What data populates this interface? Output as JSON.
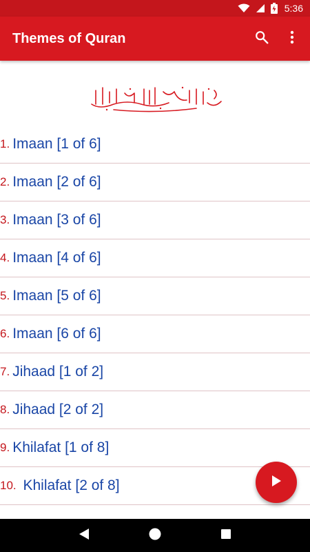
{
  "status_bar": {
    "time": "5:36",
    "icons": [
      "wifi-icon",
      "signal-icon",
      "battery-charging-icon"
    ]
  },
  "app_bar": {
    "title": "Themes of Quran",
    "actions": [
      "search-icon",
      "more-vert-icon"
    ]
  },
  "header_image": "bismillah-calligraphy",
  "themes": [
    {
      "number": "1.",
      "title": "Imaan [1 of 6]"
    },
    {
      "number": "2.",
      "title": "Imaan [2 of 6]"
    },
    {
      "number": "3.",
      "title": "Imaan [3 of 6]"
    },
    {
      "number": "4.",
      "title": "Imaan [4 of 6]"
    },
    {
      "number": "5.",
      "title": "Imaan [5 of 6]"
    },
    {
      "number": "6.",
      "title": "Imaan [6 of 6]"
    },
    {
      "number": "7.",
      "title": "Jihaad [1 of 2]"
    },
    {
      "number": "8.",
      "title": "Jihaad [2 of 2]"
    },
    {
      "number": "9.",
      "title": "Khilafat [1 of 8]"
    },
    {
      "number": "10.",
      "title": " Khilafat [2 of 8]"
    }
  ],
  "fab": "play-icon",
  "nav_bar": [
    "back-icon",
    "home-icon",
    "recents-icon"
  ],
  "colors": {
    "primary": "#d71920",
    "status": "#c4161c",
    "item_text": "#1a46a6",
    "number_text": "#c4161c",
    "divider": "#dfc3c6"
  }
}
